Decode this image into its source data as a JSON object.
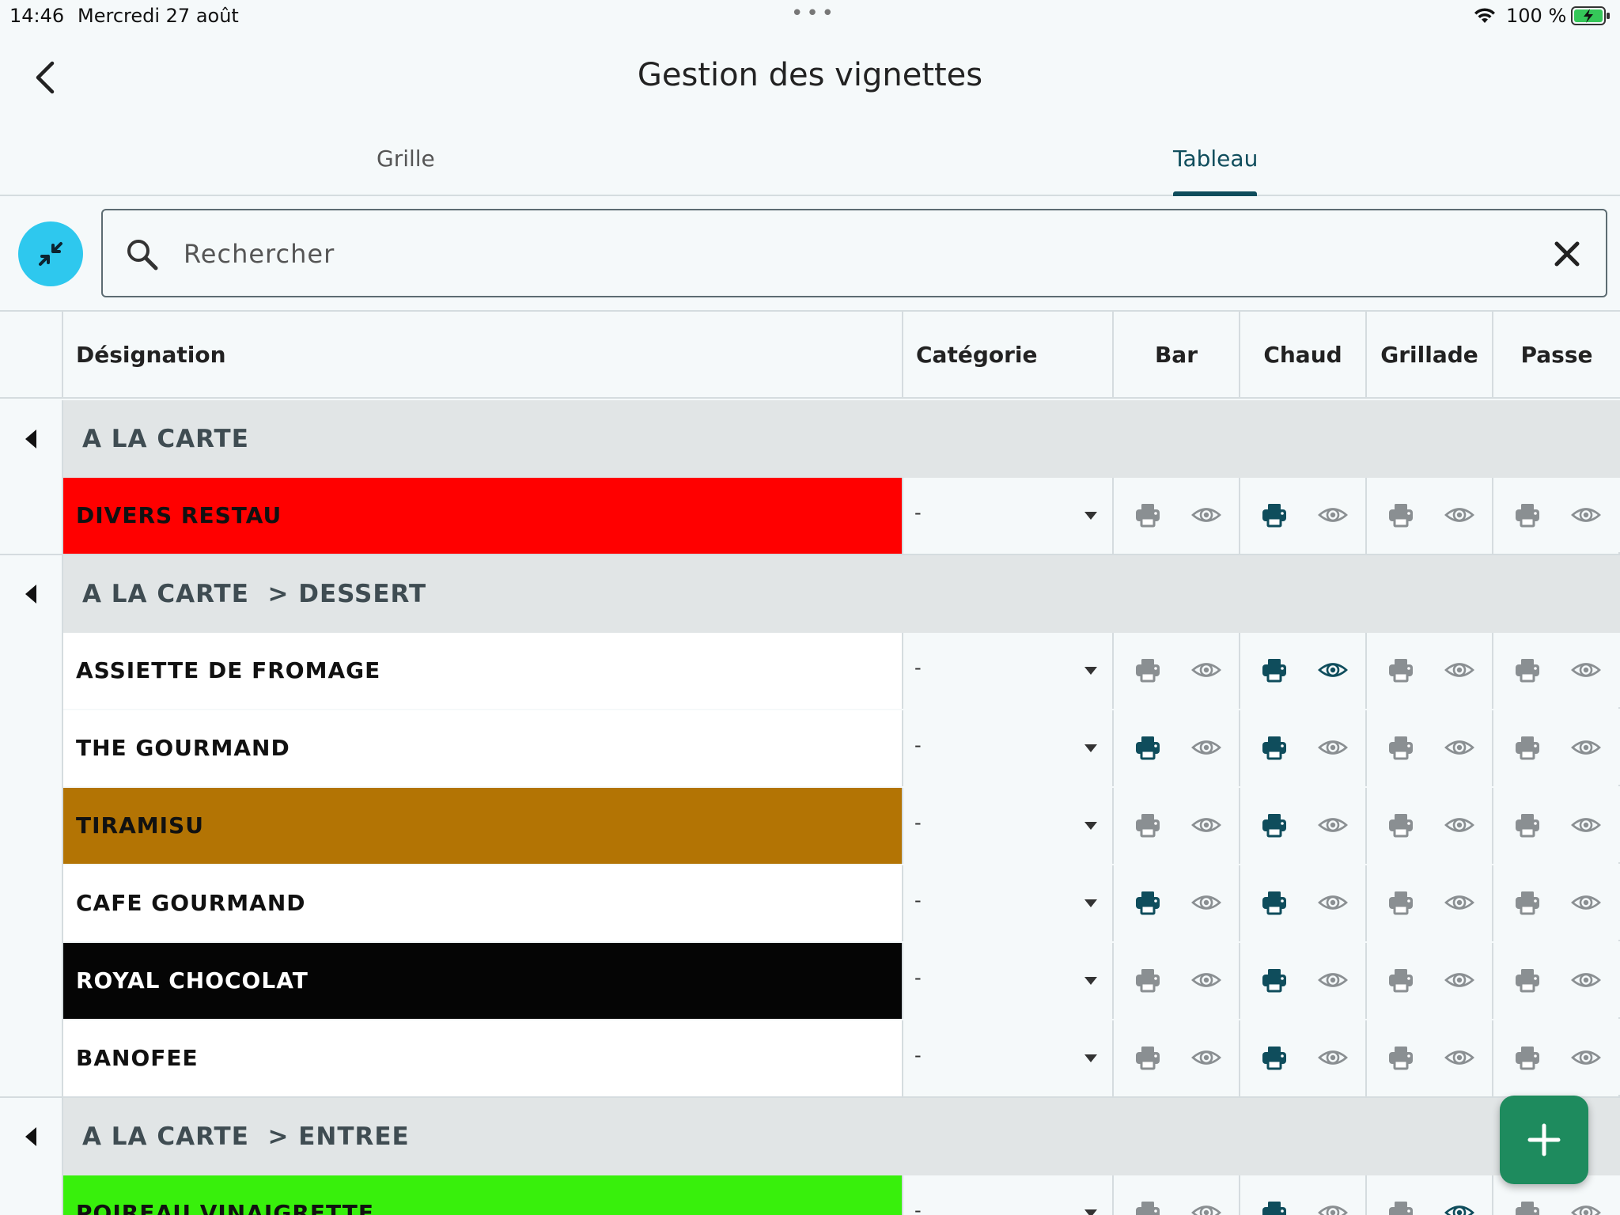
{
  "status": {
    "time": "14:46",
    "date": "Mercredi 27 août",
    "battery": "100 %"
  },
  "header": {
    "title": "Gestion des vignettes"
  },
  "tabs": [
    {
      "label": "Grille",
      "active": false
    },
    {
      "label": "Tableau",
      "active": true
    }
  ],
  "search": {
    "placeholder": "Rechercher",
    "value": ""
  },
  "columns": {
    "designation": "Désignation",
    "category": "Catégorie",
    "printers": [
      "Bar",
      "Chaud",
      "Grillade",
      "Passe"
    ]
  },
  "colors": {
    "accent": "#0f4d5c",
    "inactive_icon": "#8a8f92",
    "fab": "#1e8b5e",
    "collapse_button": "#2ec8ee"
  },
  "groups": [
    {
      "label": "A LA CARTE",
      "items": [
        {
          "name": "DIVERS RESTAU",
          "bg": "#ff0000",
          "fg": "#111111",
          "category": "-",
          "print": [
            false,
            true,
            false,
            false
          ],
          "visible": [
            false,
            false,
            false,
            false
          ]
        }
      ]
    },
    {
      "label": "A LA CARTE  > DESSERT",
      "items": [
        {
          "name": "ASSIETTE DE FROMAGE",
          "bg": "#ffffff",
          "fg": "#111111",
          "category": "-",
          "print": [
            false,
            true,
            false,
            false
          ],
          "visible": [
            false,
            true,
            false,
            false
          ]
        },
        {
          "name": "THE GOURMAND",
          "bg": "#ffffff",
          "fg": "#111111",
          "category": "-",
          "print": [
            true,
            true,
            false,
            false
          ],
          "visible": [
            false,
            false,
            false,
            false
          ]
        },
        {
          "name": "TIRAMISU",
          "bg": "#b37404",
          "fg": "#111111",
          "category": "-",
          "print": [
            false,
            true,
            false,
            false
          ],
          "visible": [
            false,
            false,
            false,
            false
          ]
        },
        {
          "name": "CAFE GOURMAND",
          "bg": "#ffffff",
          "fg": "#111111",
          "category": "-",
          "print": [
            true,
            true,
            false,
            false
          ],
          "visible": [
            false,
            false,
            false,
            false
          ]
        },
        {
          "name": "ROYAL CHOCOLAT",
          "bg": "#050505",
          "fg": "#ffffff",
          "category": "-",
          "print": [
            false,
            true,
            false,
            false
          ],
          "visible": [
            false,
            false,
            false,
            false
          ]
        },
        {
          "name": "BANOFEE",
          "bg": "#ffffff",
          "fg": "#111111",
          "category": "-",
          "print": [
            false,
            true,
            false,
            false
          ],
          "visible": [
            false,
            false,
            false,
            false
          ]
        }
      ]
    },
    {
      "label": "A LA CARTE  > ENTREE",
      "items": [
        {
          "name": "POIREAU VINAIGRETTE",
          "bg": "#38f00c",
          "fg": "#111111",
          "category": "-",
          "print": [
            false,
            true,
            false,
            false
          ],
          "visible": [
            false,
            false,
            true,
            false
          ]
        }
      ]
    }
  ],
  "icons": {
    "back": "chevron-left-icon",
    "collapse": "collapse-arrows-icon",
    "search": "search-icon",
    "clear": "close-icon",
    "add": "plus-icon",
    "printer": "printer-icon",
    "eye": "eye-icon",
    "dropdown": "caret-down-icon",
    "group_toggle": "caret-left-icon"
  }
}
